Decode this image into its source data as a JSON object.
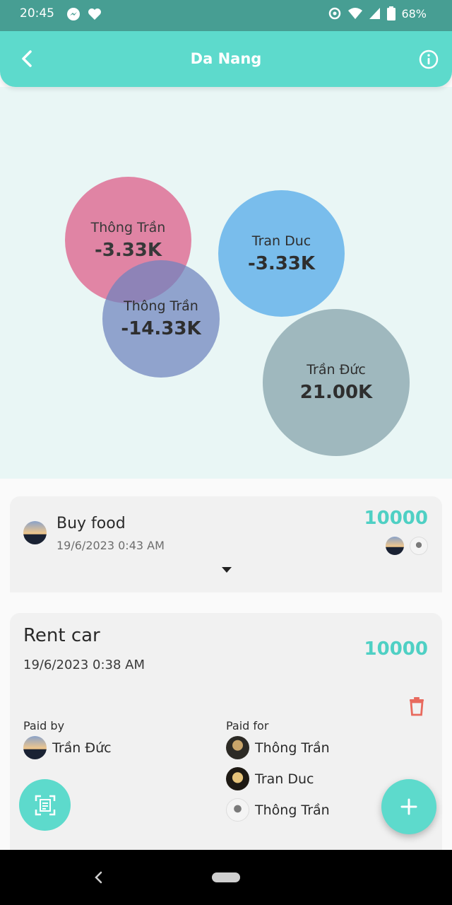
{
  "status_bar": {
    "time": "20:45",
    "battery": "68%",
    "icons": [
      "messenger-icon",
      "heart-icon",
      "sync-icon",
      "wifi-icon",
      "signal-icon",
      "battery-icon"
    ]
  },
  "app_bar": {
    "title": "Da Nang",
    "icons": [
      "back-arrow-icon",
      "info-icon"
    ]
  },
  "balances": [
    {
      "name": "Thông Trần",
      "amount": "-3.33K",
      "color": "#e07ea0"
    },
    {
      "name": "Tran Duc",
      "amount": "-3.33K",
      "color": "#79bdec"
    },
    {
      "name": "Thông Trần",
      "amount": "-14.33K",
      "color": "#8a9ac8"
    },
    {
      "name": "Trần Đức",
      "amount": "21.00K",
      "color": "#9fb8be"
    }
  ],
  "expenses": [
    {
      "title": "Buy food",
      "date": "19/6/2023 0:43 AM",
      "amount": "10000",
      "collapsed": true
    },
    {
      "title": "Rent car",
      "date": "19/6/2023 0:38 AM",
      "amount": "10000",
      "paid_by_label": "Paid by",
      "paid_for_label": "Paid for",
      "paid_by": [
        {
          "name": "Trần Đức"
        }
      ],
      "paid_for": [
        {
          "name": "Thông Trần"
        },
        {
          "name": "Tran Duc"
        },
        {
          "name": "Thông Trần"
        }
      ]
    }
  ],
  "actions": {
    "scan_icon": "scan-receipt-icon",
    "add_icon": "add-icon"
  },
  "colors": {
    "accent": "#5ddacc",
    "amount": "#4fd0c4",
    "delete": "#e86a5e"
  }
}
